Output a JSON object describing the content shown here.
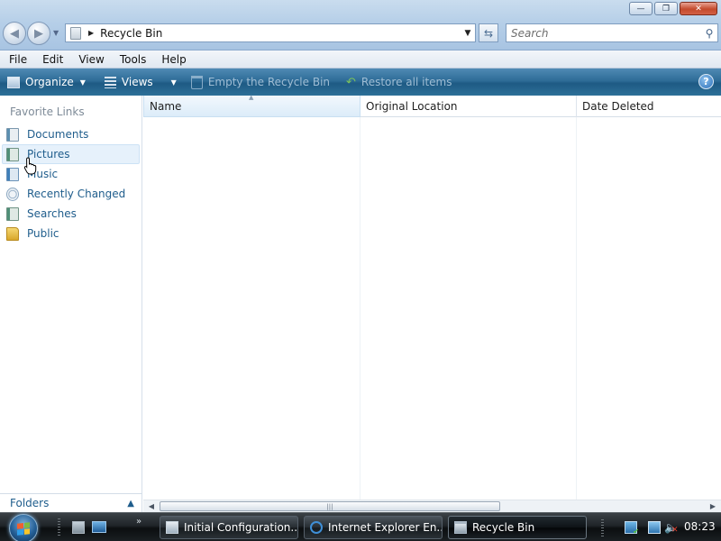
{
  "window": {
    "controls": [
      "minimize",
      "maximize",
      "close"
    ]
  },
  "address_bar": {
    "location": "Recycle Bin",
    "search_placeholder": "Search"
  },
  "menu": {
    "items": [
      "File",
      "Edit",
      "View",
      "Tools",
      "Help"
    ]
  },
  "command_bar": {
    "organize": "Organize",
    "views": "Views",
    "empty": "Empty the Recycle Bin",
    "restore": "Restore all items"
  },
  "nav_pane": {
    "heading": "Favorite Links",
    "links": [
      {
        "label": "Documents",
        "icon": "documents-icon"
      },
      {
        "label": "Pictures",
        "icon": "pictures-icon"
      },
      {
        "label": "Music",
        "icon": "music-icon"
      },
      {
        "label": "Recently Changed",
        "icon": "recently-changed-icon"
      },
      {
        "label": "Searches",
        "icon": "searches-icon"
      },
      {
        "label": "Public",
        "icon": "public-folder-icon"
      }
    ],
    "folders_label": "Folders"
  },
  "file_list": {
    "columns": [
      "Name",
      "Original Location",
      "Date Deleted"
    ],
    "rows": []
  },
  "taskbar": {
    "tasks": [
      {
        "label": "Initial Configuration...",
        "icon": "config-icon"
      },
      {
        "label": "Internet Explorer En...",
        "icon": "ie-icon"
      },
      {
        "label": "Recycle Bin",
        "icon": "recycle-bin-icon"
      }
    ],
    "clock": "08:23"
  },
  "colors": {
    "command_bar": "#2e6c97",
    "link": "#1f5d8c",
    "taskbar": "#1f2428"
  }
}
